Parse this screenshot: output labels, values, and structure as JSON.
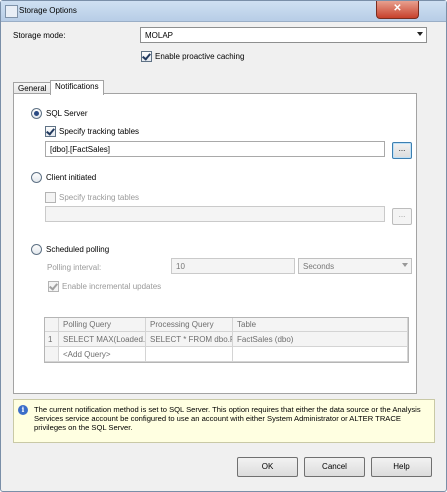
{
  "window": {
    "title": "Storage Options",
    "close_glyph": "✕"
  },
  "storage_mode": {
    "label": "Storage mode:",
    "value": "MOLAP"
  },
  "proactive_caching": {
    "label": "Enable proactive caching",
    "checked": true
  },
  "tabs": [
    {
      "label": "General"
    },
    {
      "label": "Notifications"
    }
  ],
  "notifications": {
    "sql_server": {
      "label": "SQL Server",
      "selected": true,
      "tracking": {
        "label": "Specify tracking tables",
        "checked": true
      },
      "tables_value": "[dbo].[FactSales]",
      "browse_label": "..."
    },
    "client_initiated": {
      "label": "Client initiated",
      "selected": false,
      "tracking": {
        "label": "Specify tracking tables",
        "checked": false
      },
      "tables_value": "",
      "browse_label": "..."
    },
    "scheduled_polling": {
      "label": "Scheduled polling",
      "selected": false,
      "interval_label": "Polling interval:",
      "interval_value": "10",
      "interval_unit": "Seconds",
      "incremental": {
        "label": "Enable incremental updates",
        "checked": true
      },
      "grid": {
        "columns": [
          "Polling Query",
          "Processing Query",
          "Table"
        ],
        "rows": [
          {
            "num": "1",
            "polling": "SELECT MAX(Loaded...",
            "processing": "SELECT * FROM dbo.F...",
            "table": "FactSales (dbo)"
          }
        ],
        "add_row": "<Add Query>"
      }
    }
  },
  "info_message": "The current notification method is set to SQL Server. This option requires that either the data source or the Analysis Services service account be configured to use an account with either System Administrator or ALTER TRACE privileges on the SQL Server.",
  "buttons": {
    "ok": "OK",
    "cancel": "Cancel",
    "help": "Help"
  }
}
